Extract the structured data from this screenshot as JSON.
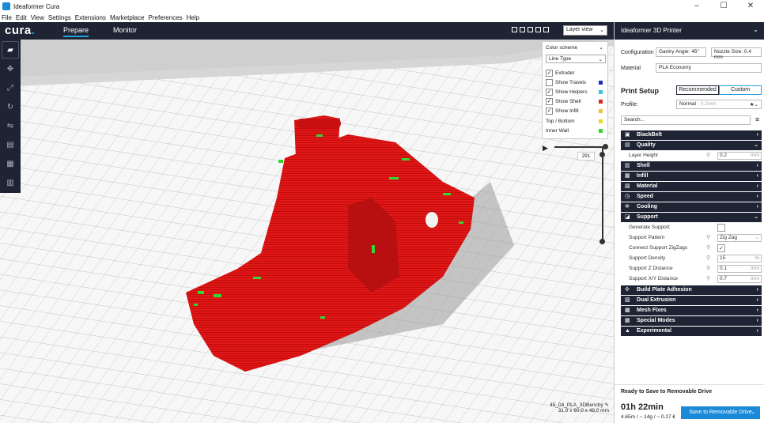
{
  "window": {
    "title": "Ideaformer Cura",
    "controls": [
      "–",
      "☐",
      "✕"
    ]
  },
  "menu": [
    "File",
    "Edit",
    "View",
    "Settings",
    "Extensions",
    "Marketplace",
    "Preferences",
    "Help"
  ],
  "header": {
    "logo_text": "cura",
    "logo_dot": ".",
    "tabs": [
      "Prepare",
      "Monitor"
    ],
    "active_tab": "Prepare",
    "view_select": "Layer view",
    "view_chevron": "⌄"
  },
  "color_panel": {
    "title": "Color scheme",
    "scheme": "Line Type",
    "items": [
      {
        "label": "Extruder",
        "checked": true,
        "color": ""
      },
      {
        "label": "Show Travels",
        "checked": false,
        "color": "#1b2eb8"
      },
      {
        "label": "Show Helpers",
        "checked": true,
        "color": "#39c6d6"
      },
      {
        "label": "Show Shell",
        "checked": true,
        "color": "#e02424"
      },
      {
        "label": "Show Infill",
        "checked": true,
        "color": "#e8c33a"
      }
    ],
    "extra": [
      {
        "label": "Top / Bottom",
        "color": "#f0d828"
      },
      {
        "label": "Inner Wall",
        "color": "#33d633"
      }
    ]
  },
  "layer_slider": {
    "value": "291"
  },
  "object_info": {
    "name": "45_04_PLA_3DBenchy",
    "dims": "31.0 x 60.0 x 48.0 mm"
  },
  "right_panel": {
    "printer": "Ideaformer 3D Printer",
    "configuration_label": "Configuration",
    "gantry": "Gantry Angle: 45°",
    "nozzle": "Nozzle Size: 0.4 mm",
    "material_label": "Material",
    "material": "PLA Economy",
    "print_setup": "Print Setup",
    "recommended": "Recommended",
    "custom": "Custom",
    "profile_label": "Profile:",
    "profile": "Normal",
    "profile_suffix": "- 0.2mm",
    "search_placeholder": "Search...",
    "menu_icon": "≡"
  },
  "settings": [
    {
      "type": "cat",
      "label": "BlackBelt",
      "icon": "▣"
    },
    {
      "type": "cat",
      "label": "Quality",
      "icon": "▤"
    },
    {
      "type": "set",
      "label": "Layer Height",
      "value": "0.2",
      "unit": "mm"
    },
    {
      "type": "cat",
      "label": "Shell",
      "icon": "▥"
    },
    {
      "type": "cat",
      "label": "Infill",
      "icon": "▦"
    },
    {
      "type": "cat",
      "label": "Material",
      "icon": "▧"
    },
    {
      "type": "cat",
      "label": "Speed",
      "icon": "◷"
    },
    {
      "type": "cat",
      "label": "Cooling",
      "icon": "✲"
    },
    {
      "type": "cat",
      "label": "Support",
      "icon": "◪"
    },
    {
      "type": "check",
      "label": "Generate Support",
      "checked": false
    },
    {
      "type": "set",
      "label": "Support Pattern",
      "value": "Zig Zag",
      "unit": "⌄"
    },
    {
      "type": "check",
      "label": "Connect Support ZigZags",
      "checked": true
    },
    {
      "type": "set",
      "label": "Support Density",
      "value": "15",
      "unit": "%"
    },
    {
      "type": "set",
      "label": "Support Z Distance",
      "value": "0.1",
      "unit": "mm"
    },
    {
      "type": "set",
      "label": "Support X/Y Distance",
      "value": "0.7",
      "unit": "mm"
    },
    {
      "type": "cat",
      "label": "Build Plate Adhesion",
      "icon": "✣"
    },
    {
      "type": "cat",
      "label": "Dual Extrusion",
      "icon": "▨"
    },
    {
      "type": "cat",
      "label": "Mesh Fixes",
      "icon": "▩"
    },
    {
      "type": "cat",
      "label": "Special Modes",
      "icon": "▦"
    },
    {
      "type": "cat",
      "label": "Experimental",
      "icon": "▲"
    }
  ],
  "status": {
    "ready": "Ready to Save to Removable Drive",
    "time": "01h 22min",
    "details": "4.65m / ~ 14g / ~ 0.27 €",
    "save_button": "Save to Removable Drive",
    "save_chevron": "⌄"
  }
}
